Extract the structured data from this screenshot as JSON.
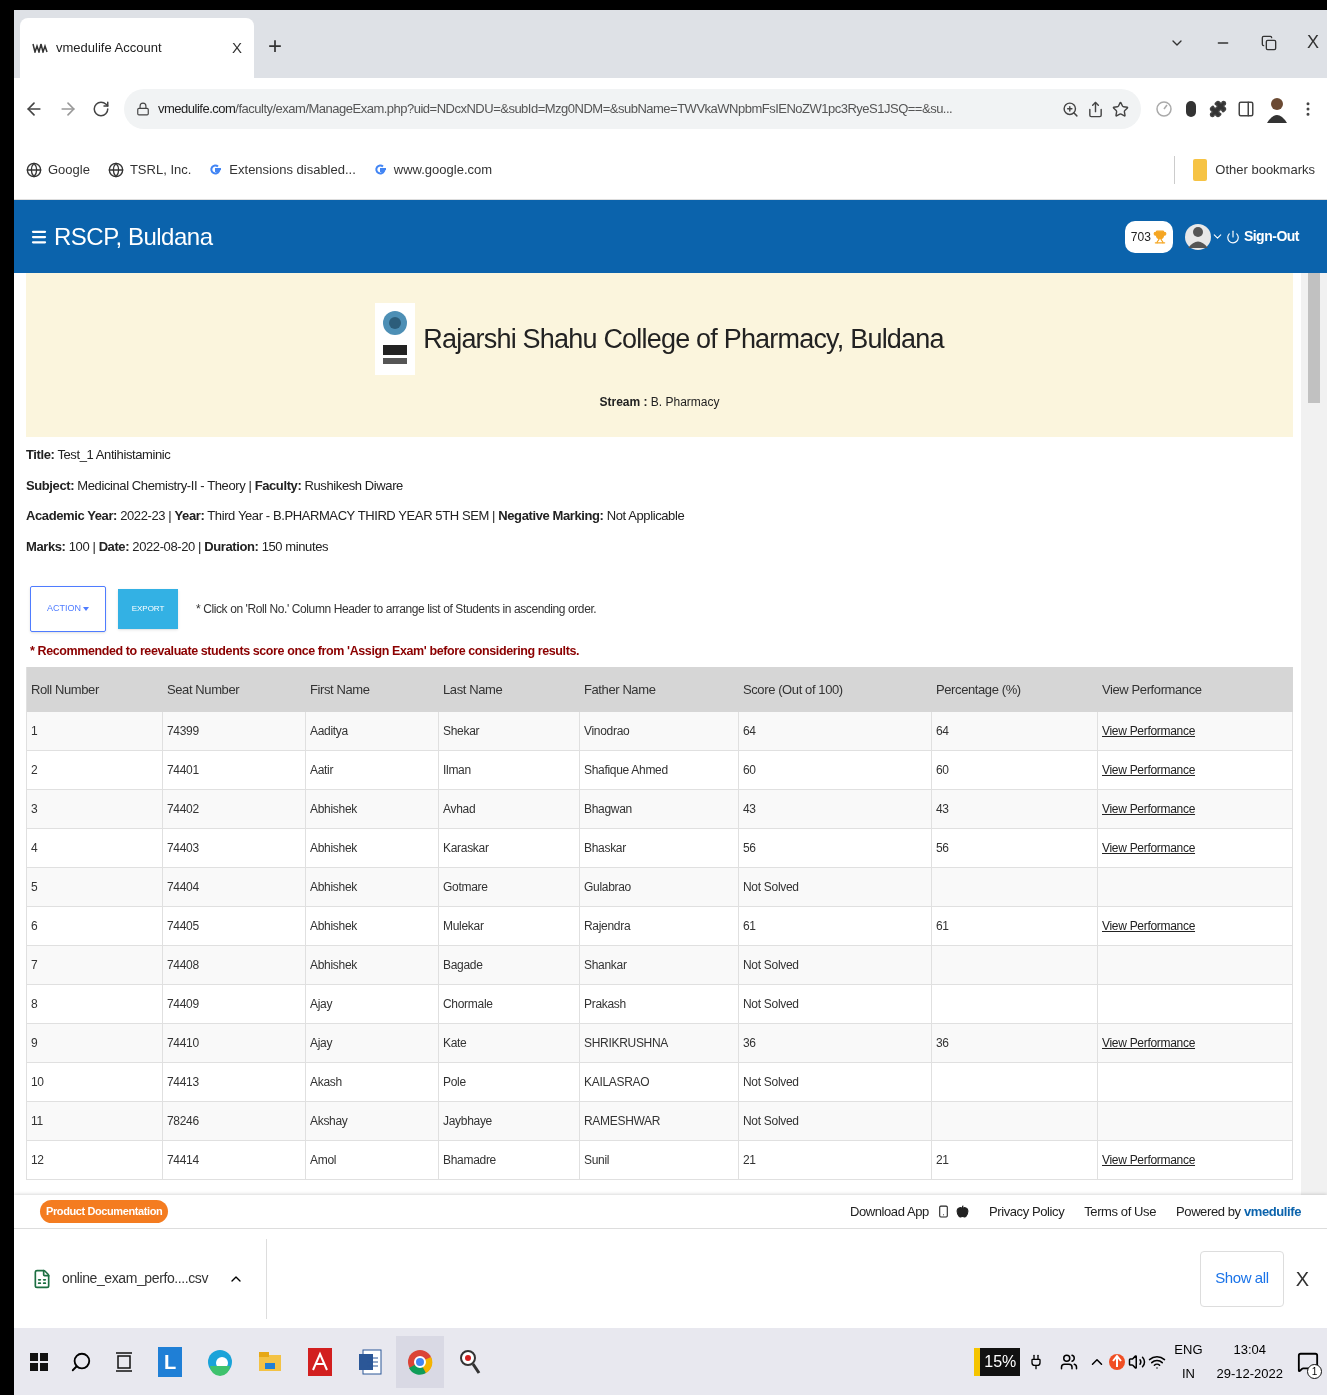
{
  "browser": {
    "tab": {
      "title": "vmedulife Account",
      "close": "X",
      "selected": true
    },
    "new_tab": "+",
    "url_domain": "vmedulife.com",
    "url_path": "/faculty/exam/ManageExam.php?uid=NDcxNDU=&subId=Mzg0NDM=&subName=TWVkaWNpbmFsIENoZW1pc3RyeS1JSQ==&su...",
    "window_close": "X",
    "bookmarks": [
      {
        "label": "Google",
        "kind": "globe"
      },
      {
        "label": "TSRL, Inc.",
        "kind": "globe"
      },
      {
        "label": "Extensions disabled...",
        "kind": "g"
      },
      {
        "label": "www.google.com",
        "kind": "g"
      }
    ],
    "other_bookmarks": "Other bookmarks"
  },
  "header": {
    "brand": "RSCP, Buldana",
    "points": "703",
    "sign_out": "Sign-Out"
  },
  "banner": {
    "college": "Rajarshi Shahu College of Pharmacy, Buldana",
    "stream": "**Stream :** B. Pharmacy"
  },
  "info": [
    "**Title:** Test_1 Antihistaminic",
    "**Subject:** Medicinal Chemistry-II - Theory | **Faculty:** Rushikesh Diware",
    "**Academic Year:** 2022-23 | **Year:** Third Year - B.PHARMACY THIRD YEAR 5TH SEM | **Negative Marking:** Not Applicable",
    "**Marks:** 100 | **Date:** 2022-08-20 | **Duration:** 150 minutes"
  ],
  "actions": {
    "action": "ACTION",
    "export": "EXPORT",
    "hint": "* Click on 'Roll No.' Column Header to arrange list of Students in ascending order."
  },
  "notice": "* Recommended to reevaluate students score once from 'Assign Exam' before considering results.",
  "table": {
    "columns": [
      "Roll Number",
      "Seat Number",
      "First Name",
      "Last Name",
      "Father Name",
      "Score (Out of 100)",
      "Percentage (%)",
      "View Performance"
    ],
    "rows": [
      {
        "roll": "1",
        "seat": "74399",
        "first_name": "Aaditya",
        "last_name": "Shekar",
        "father_name": "Vinodrao",
        "score": "64",
        "percentage": "64",
        "link": "View Performance"
      },
      {
        "roll": "2",
        "seat": "74401",
        "first_name": "Aatir",
        "last_name": "Ilman",
        "father_name": "Shafique Ahmed",
        "score": "60",
        "percentage": "60",
        "link": "View Performance"
      },
      {
        "roll": "3",
        "seat": "74402",
        "first_name": "Abhishek",
        "last_name": "Avhad",
        "father_name": "Bhagwan",
        "score": "43",
        "percentage": "43",
        "link": "View Performance"
      },
      {
        "roll": "4",
        "seat": "74403",
        "first_name": "Abhishek",
        "last_name": "Karaskar",
        "father_name": "Bhaskar",
        "score": "56",
        "percentage": "56",
        "link": "View Performance"
      },
      {
        "roll": "5",
        "seat": "74404",
        "first_name": "Abhishek",
        "last_name": "Gotmare",
        "father_name": "Gulabrao",
        "score": "Not Solved"
      },
      {
        "roll": "6",
        "seat": "74405",
        "first_name": "Abhishek",
        "last_name": "Mulekar",
        "father_name": "Rajendra",
        "score": "61",
        "percentage": "61",
        "link": "View Performance"
      },
      {
        "roll": "7",
        "seat": "74408",
        "first_name": "Abhishek",
        "last_name": "Bagade",
        "father_name": "Shankar",
        "score": "Not Solved"
      },
      {
        "roll": "8",
        "seat": "74409",
        "first_name": "Ajay",
        "last_name": "Chormale",
        "father_name": "Prakash",
        "score": "Not Solved"
      },
      {
        "roll": "9",
        "seat": "74410",
        "first_name": "Ajay",
        "last_name": "Kate",
        "father_name": "SHRIKRUSHNA",
        "score": "36",
        "percentage": "36",
        "link": "View Performance"
      },
      {
        "roll": "10",
        "seat": "74413",
        "first_name": "Akash",
        "last_name": "Pole",
        "father_name": "KAILASRAO",
        "score": "Not Solved"
      },
      {
        "roll": "11",
        "seat": "78246",
        "first_name": "Akshay",
        "last_name": "Jaybhaye",
        "father_name": "RAMESHWAR",
        "score": "Not Solved"
      },
      {
        "roll": "12",
        "seat": "74414",
        "first_name": "Amol",
        "last_name": "Bhamadre",
        "father_name": "Sunil",
        "score": "21",
        "percentage": "21",
        "link": "View Performance"
      }
    ]
  },
  "footer": {
    "docs": "Product Documentation",
    "download_app": "Download App",
    "links": [
      "Privacy Policy",
      "Terms of Use"
    ],
    "powered_by": "Powered by",
    "powered_brand": "vmedulife"
  },
  "downloads": {
    "file": "online_exam_perfo....csv",
    "show_all": "Show all",
    "close": "X"
  },
  "taskbar": {
    "apps": [
      {
        "kind": "launcher"
      },
      {
        "kind": "edge"
      },
      {
        "kind": "files"
      },
      {
        "kind": "pdf"
      },
      {
        "kind": "word"
      },
      {
        "kind": "chrome",
        "selected": true
      },
      {
        "kind": "magnifier"
      }
    ],
    "launcher_letter": "L",
    "battery": "15%",
    "lang": "ENG",
    "region": "IN",
    "time": "13:04",
    "date": "29-12-2022",
    "notifications": "1"
  }
}
